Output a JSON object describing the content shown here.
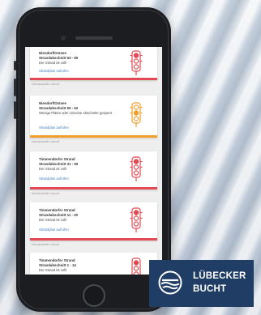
{
  "colors": {
    "red": "#e24b53",
    "orange": "#f0a02b",
    "link": "#3f7fbf",
    "brand_blue": "#1f3d65"
  },
  "beaches": [
    {
      "name_line1": "Niendorf/Ostsee",
      "name_line2": "Strandabschnitt 63 - 80",
      "status": "Der Strand ist voll!",
      "link": "Strandplan aufrufen",
      "footnote": "Datenaktualität: manuell",
      "status_color": "red"
    },
    {
      "name_line1": "Niendorf/Ostsee",
      "name_line2": "Strandabschnitt 50 - 62",
      "status": "Wenige Plätze oder einzelne Abschnitte gesperrt",
      "link": "Strandplan aufrufen",
      "footnote": "Datenaktualität: manuell",
      "status_color": "orange"
    },
    {
      "name_line1": "Timmendorfer Strand",
      "name_line2": "Strandabschnitt 31 - 50",
      "status": "Der Strand ist voll!",
      "link": "Strandplan aufrufen",
      "footnote": "Datenaktualität: manuell",
      "status_color": "red"
    },
    {
      "name_line1": "Timmendorfer Strand",
      "name_line2": "Strandabschnitt 11 - 30",
      "status": "Der Strand ist voll!",
      "link": "Strandplan aufrufen",
      "footnote": "Datenaktualität: manuell",
      "status_color": "red"
    },
    {
      "name_line1": "Timmendorfer Strand",
      "name_line2": "Strandabschnitt 1 - 14",
      "status": "Der Strand ist voll!",
      "link": "",
      "footnote": "",
      "status_color": "red"
    }
  ],
  "logo": {
    "line1": "LÜBECKER",
    "line2": "BUCHT"
  },
  "icons": {
    "traffic_light": "traffic-light-icon",
    "logo_mark": "wave-logo-icon"
  }
}
